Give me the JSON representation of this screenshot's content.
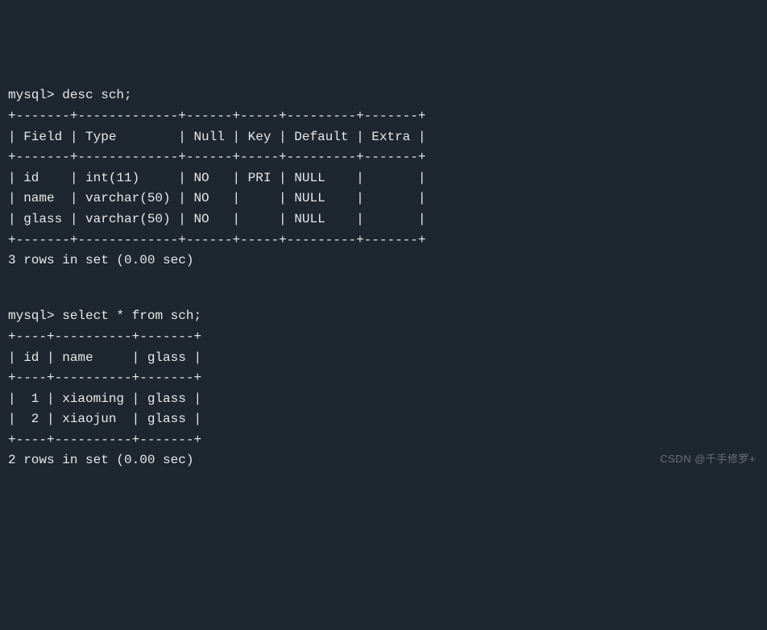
{
  "session": {
    "prompt": "mysql>",
    "cmd_desc": "desc sch;",
    "cmd_select": "select * from sch;"
  },
  "desc_table": {
    "border_top": "+-------+-------------+------+-----+---------+-------+",
    "header_line": "| Field | Type        | Null | Key | Default | Extra |",
    "border_mid": "+-------+-------------+------+-----+---------+-------+",
    "rows": [
      "| id    | int(11)     | NO   | PRI | NULL    |       |",
      "| name  | varchar(50) | NO   |     | NULL    |       |",
      "| glass | varchar(50) | NO   |     | NULL    |       |"
    ],
    "border_bot": "+-------+-------------+------+-----+---------+-------+",
    "summary": "3 rows in set (0.00 sec)"
  },
  "select_table": {
    "border_top": "+----+----------+-------+",
    "header_line": "| id | name     | glass |",
    "border_mid": "+----+----------+-------+",
    "rows": [
      "|  1 | xiaoming | glass |",
      "|  2 | xiaojun  | glass |"
    ],
    "border_bot": "+----+----------+-------+",
    "summary": "2 rows in set (0.00 sec)"
  },
  "watermark": "CSDN @千手修罗+",
  "chart_data": {
    "type": "table",
    "tables": [
      {
        "name": "describe sch",
        "columns": [
          "Field",
          "Type",
          "Null",
          "Key",
          "Default",
          "Extra"
        ],
        "rows": [
          [
            "id",
            "int(11)",
            "NO",
            "PRI",
            "NULL",
            ""
          ],
          [
            "name",
            "varchar(50)",
            "NO",
            "",
            "NULL",
            ""
          ],
          [
            "glass",
            "varchar(50)",
            "NO",
            "",
            "NULL",
            ""
          ]
        ],
        "row_count": 3,
        "elapsed_sec": 0.0
      },
      {
        "name": "select * from sch",
        "columns": [
          "id",
          "name",
          "glass"
        ],
        "rows": [
          [
            1,
            "xiaoming",
            "glass"
          ],
          [
            2,
            "xiaojun",
            "glass"
          ]
        ],
        "row_count": 2,
        "elapsed_sec": 0.0
      }
    ]
  }
}
